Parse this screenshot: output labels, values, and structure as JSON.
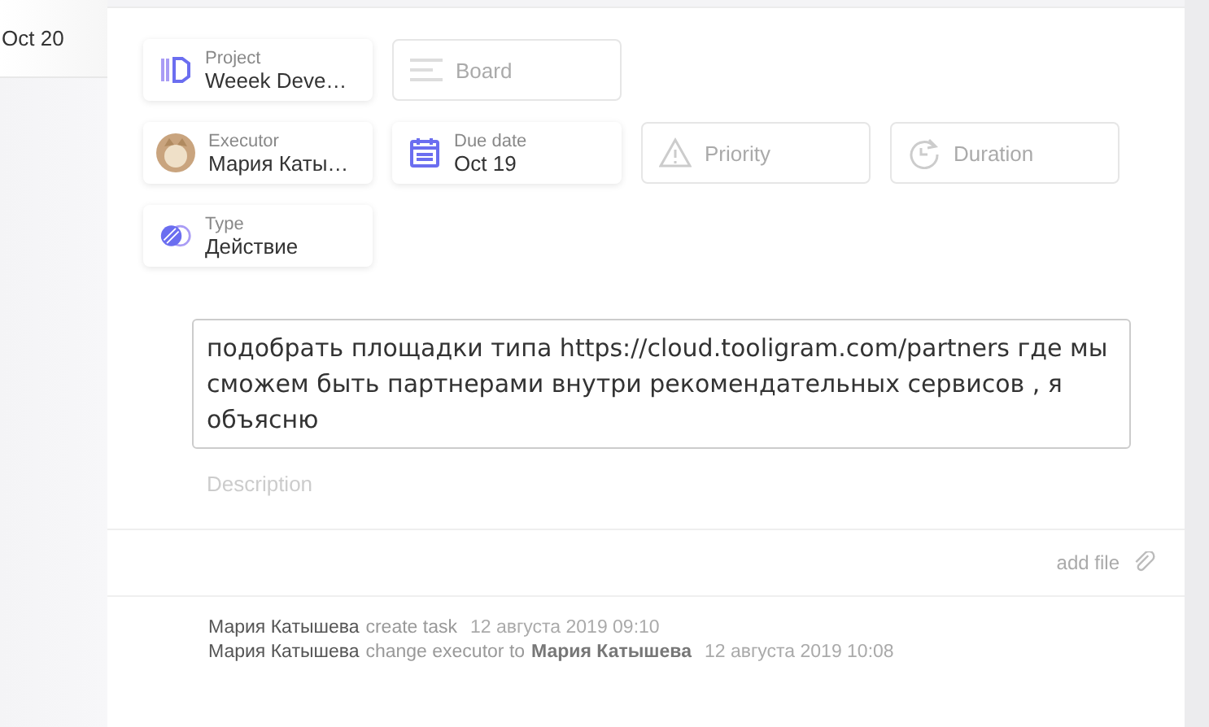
{
  "sidebar": {
    "date": "Oct 20"
  },
  "fields": [
    [
      {
        "kind": "value",
        "label": "Project",
        "value": "Weeek Deve…"
      },
      {
        "kind": "empty",
        "placeholder": "Board"
      }
    ],
    [
      {
        "kind": "value",
        "label": "Executor",
        "value": "Мария Каты…"
      },
      {
        "kind": "value",
        "label": "Due date",
        "value": "Oct 19"
      },
      {
        "kind": "empty",
        "placeholder": "Priority"
      },
      {
        "kind": "empty",
        "placeholder": "Duration"
      }
    ],
    [
      {
        "kind": "value",
        "label": "Type",
        "value": "Действие"
      }
    ]
  ],
  "task_text": "подобрать площадки типа https://cloud.tooligram.com/partners где мы сможем быть партнерами внутри рекомендательных сервисов , я объясню",
  "description": {
    "placeholder": "Description"
  },
  "attach": {
    "label": "add file"
  },
  "activity": [
    {
      "user": "Мария Катышева",
      "action": "create task",
      "time": "12 августа 2019 09:10"
    },
    {
      "user": "Мария Катышева",
      "action": "change executor to",
      "target": "Мария Катышева",
      "time": "12 августа 2019 10:08"
    }
  ]
}
